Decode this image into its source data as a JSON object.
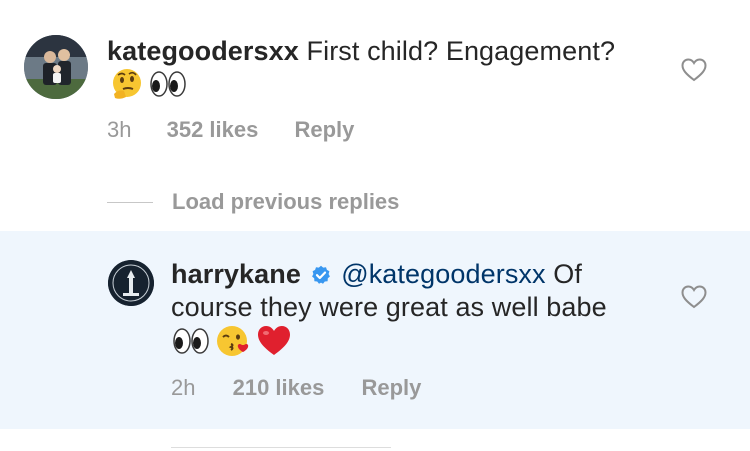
{
  "comment": {
    "username": "kategoodersxx",
    "text": "First child? Engagement?",
    "emojis": [
      "thinking-face",
      "eyes"
    ],
    "time": "3h",
    "likes": "352 likes",
    "reply_label": "Reply"
  },
  "load_previous": {
    "label": "Load previous replies"
  },
  "reply": {
    "username": "harrykane",
    "verified": true,
    "mention": "@kategoodersxx",
    "text_line1": "Of",
    "text_line2": "course they were great as well babe",
    "emojis": [
      "eyes",
      "face-blowing-kiss",
      "red-heart"
    ],
    "time": "2h",
    "likes": "210 likes",
    "reply_label": "Reply"
  },
  "colors": {
    "reply_background": "#eff6fd",
    "verified_badge": "#3897f0",
    "mention": "#003569",
    "meta_text": "#999999"
  }
}
